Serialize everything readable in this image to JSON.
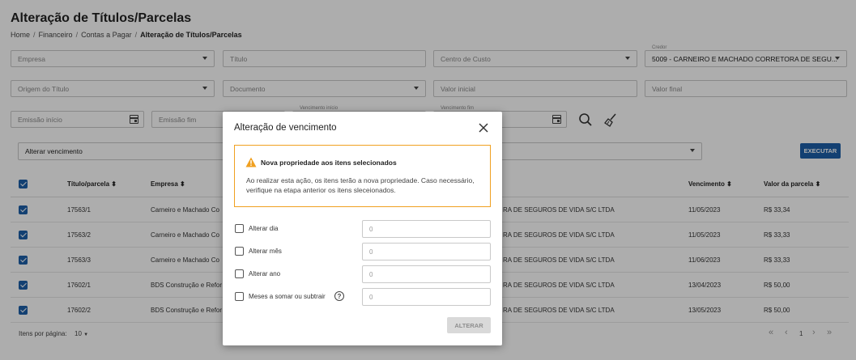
{
  "page": {
    "title": "Alteração de Títulos/Parcelas",
    "breadcrumb": [
      "Home",
      "Financeiro",
      "Contas a Pagar",
      "Alteração de Títulos/Parcelas"
    ]
  },
  "filters": {
    "empresa": "Empresa",
    "titulo": "Título",
    "centro_custo": "Centro de Custo",
    "credor_label": "Credor",
    "credor_value": "5009 - CARNEIRO E MACHADO CORRETORA DE SEGU...",
    "origem": "Origem do Título",
    "documento": "Documento",
    "valor_inicial": "Valor inicial",
    "valor_final": "Valor final",
    "emissao_inicio": "Emissão início",
    "emissao_fim": "Emissão fim",
    "venc_inicio_label": "Vencimento início",
    "venc_fim_label": "Vencimento fim"
  },
  "action": {
    "selected": "Alterar vencimento",
    "execute_label": "EXECUTAR"
  },
  "table": {
    "headers": [
      "Título/parcela ⬍",
      "Empresa ⬍",
      "Vencimento ⬍",
      "Valor da parcela ⬍"
    ],
    "rows": [
      {
        "titulo": "17563/1",
        "empresa": "Carneiro e Machado Co",
        "credor": "RA DE SEGUROS DE VIDA S/C LTDA",
        "vencimento": "11/05/2023",
        "valor": "R$ 33,34"
      },
      {
        "titulo": "17563/2",
        "empresa": "Carneiro e Machado Co",
        "credor": "RA DE SEGUROS DE VIDA S/C LTDA",
        "vencimento": "11/05/2023",
        "valor": "R$ 33,33"
      },
      {
        "titulo": "17563/3",
        "empresa": "Carneiro e Machado Co",
        "credor": "RA DE SEGUROS DE VIDA S/C LTDA",
        "vencimento": "11/06/2023",
        "valor": "R$ 33,33"
      },
      {
        "titulo": "17602/1",
        "empresa": "BDS Construção e Refor",
        "credor": "RA DE SEGUROS DE VIDA S/C LTDA",
        "vencimento": "13/04/2023",
        "valor": "R$ 50,00"
      },
      {
        "titulo": "17602/2",
        "empresa": "BDS Construção e Refor",
        "credor": "RA DE SEGUROS DE VIDA S/C LTDA",
        "vencimento": "13/05/2023",
        "valor": "R$ 50,00"
      }
    ]
  },
  "footer": {
    "items_per_page_label": "Itens por página:",
    "items_per_page_value": "10",
    "current_page": "1"
  },
  "modal": {
    "title": "Alteração de vencimento",
    "alert_title": "Nova propriedade aos itens selecionados",
    "alert_text": "Ao realizar esta ação, os itens terão a nova propriedade. Caso necessário, verifique na etapa anterior os itens sleceionados.",
    "options": [
      {
        "label": "Alterar dia",
        "value": "0"
      },
      {
        "label": "Alterar mês",
        "value": "0"
      },
      {
        "label": "Alterar ano",
        "value": "0"
      },
      {
        "label": "Meses a somar ou subtrair",
        "value": "0"
      }
    ],
    "help_symbol": "?",
    "submit_label": "ALTERAR"
  },
  "colors": {
    "primary": "#1c5fa8",
    "warning": "#f0a020"
  }
}
